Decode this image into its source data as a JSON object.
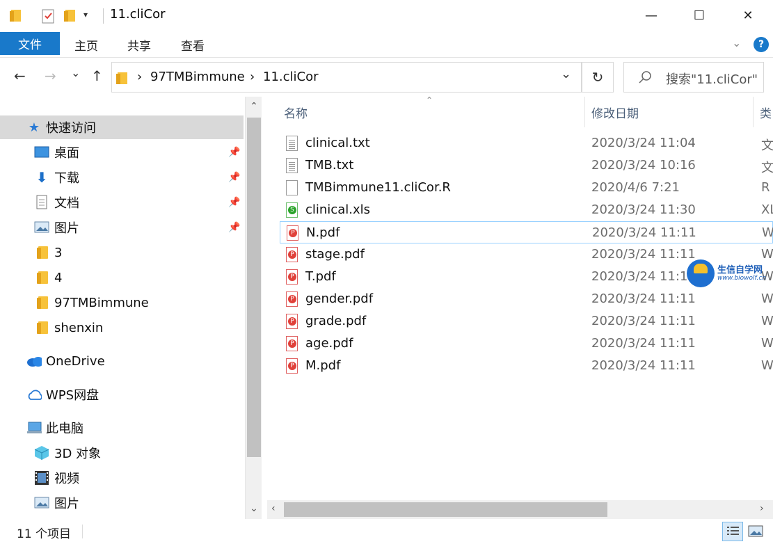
{
  "window": {
    "title": "11.cliCor",
    "minimize": "—",
    "maximize": "☐",
    "close": "✕"
  },
  "ribbon": {
    "tabs": [
      {
        "label": "文件",
        "active": true
      },
      {
        "label": "主页"
      },
      {
        "label": "共享"
      },
      {
        "label": "查看"
      }
    ],
    "help": "?"
  },
  "nav": {
    "back": "←",
    "forward": "→",
    "recent": "⌄",
    "up": "↑",
    "breadcrumb": [
      "97TMBimmune",
      "11.cliCor"
    ],
    "separator": "›",
    "dropdown": "⌄",
    "refresh": "↻",
    "search_placeholder": "搜索\"11.cliCor\""
  },
  "sidebar": {
    "items": [
      {
        "label": "快速访问",
        "icon": "star-icon",
        "selected": true
      },
      {
        "label": "桌面",
        "icon": "desktop-icon",
        "pinned": true
      },
      {
        "label": "下载",
        "icon": "download-icon",
        "pinned": true
      },
      {
        "label": "文档",
        "icon": "document-icon",
        "pinned": true
      },
      {
        "label": "图片",
        "icon": "picture-icon",
        "pinned": true
      },
      {
        "label": "3",
        "icon": "folder-icon"
      },
      {
        "label": "4",
        "icon": "folder-icon"
      },
      {
        "label": "97TMBimmune",
        "icon": "folder-icon"
      },
      {
        "label": "shenxin",
        "icon": "folder-icon"
      },
      {
        "label": "OneDrive",
        "icon": "cloud-icon"
      },
      {
        "label": "WPS网盘",
        "icon": "wps-cloud-icon"
      },
      {
        "label": "此电脑",
        "icon": "computer-icon"
      },
      {
        "label": "3D 对象",
        "icon": "cube-icon"
      },
      {
        "label": "视频",
        "icon": "video-icon"
      },
      {
        "label": "图片",
        "icon": "picture-icon"
      }
    ]
  },
  "filelist": {
    "columns": {
      "name": "名称",
      "date": "修改日期",
      "type": "类"
    },
    "files": [
      {
        "name": "clinical.txt",
        "date": "2020/3/24 11:04",
        "type": "文",
        "kind": "txt"
      },
      {
        "name": "TMB.txt",
        "date": "2020/3/24 10:16",
        "type": "文",
        "kind": "txt"
      },
      {
        "name": "TMBimmune11.cliCor.R",
        "date": "2020/4/6 7:21",
        "type": "R",
        "kind": "blank"
      },
      {
        "name": "clinical.xls",
        "date": "2020/3/24 11:30",
        "type": "XL",
        "kind": "xls"
      },
      {
        "name": "N.pdf",
        "date": "2020/3/24 11:11",
        "type": "W",
        "kind": "pdf",
        "hover": true
      },
      {
        "name": "stage.pdf",
        "date": "2020/3/24 11:11",
        "type": "W",
        "kind": "pdf"
      },
      {
        "name": "T.pdf",
        "date": "2020/3/24 11:11",
        "type": "W",
        "kind": "pdf"
      },
      {
        "name": "gender.pdf",
        "date": "2020/3/24 11:11",
        "type": "W",
        "kind": "pdf"
      },
      {
        "name": "grade.pdf",
        "date": "2020/3/24 11:11",
        "type": "W",
        "kind": "pdf"
      },
      {
        "name": "age.pdf",
        "date": "2020/3/24 11:11",
        "type": "W",
        "kind": "pdf"
      },
      {
        "name": "M.pdf",
        "date": "2020/3/24 11:11",
        "type": "W",
        "kind": "pdf"
      }
    ]
  },
  "watermark": {
    "line1": "生信自学网",
    "line2": "www.biowolf.cn"
  },
  "status": {
    "count": "11 个项目"
  },
  "colors": {
    "accent": "#1979ca",
    "selected": "#d9d9d9",
    "hover_border": "#99d1ff"
  }
}
